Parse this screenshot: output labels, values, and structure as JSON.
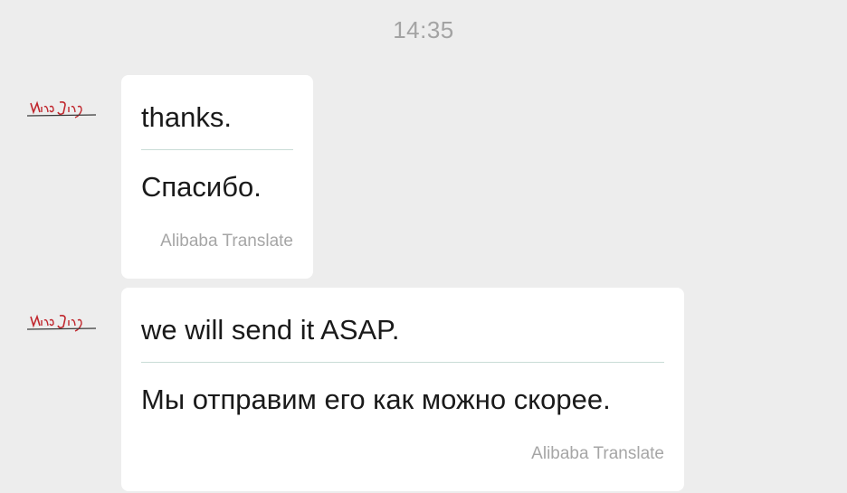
{
  "chat": {
    "timestamp": "14:35",
    "accent_divider_color": "#c9dcd6",
    "messages": [
      {
        "sender_avatar_text": "NinaJing",
        "original": "thanks.",
        "translation": "Спасибо.",
        "provider": "Alibaba Translate"
      },
      {
        "sender_avatar_text": "NinaJing",
        "original": "we will send it ASAP.",
        "translation": "Мы отправим его как можно скорее.",
        "provider": "Alibaba Translate"
      }
    ]
  }
}
